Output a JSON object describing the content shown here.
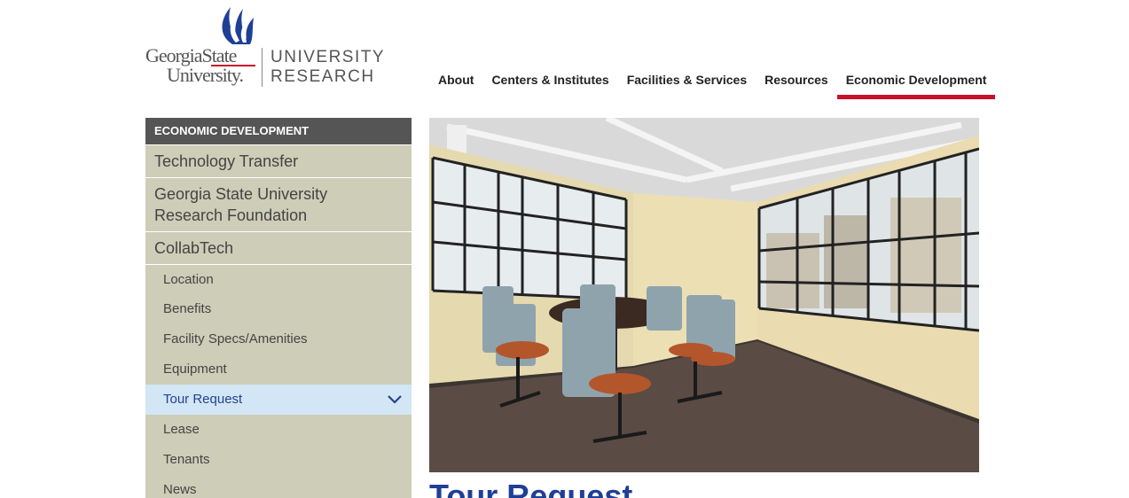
{
  "logo": {
    "line1": "GeorgiaState",
    "line2": "University.",
    "unit_line1": "UNIVERSITY",
    "unit_line2": "RESEARCH",
    "brand_blue": "#1f3f97",
    "brand_red": "#c8102e"
  },
  "topnav": {
    "items": [
      {
        "label": "About"
      },
      {
        "label": "Centers & Institutes"
      },
      {
        "label": "Facilities & Services"
      },
      {
        "label": "Resources"
      },
      {
        "label": "Economic Development"
      }
    ],
    "active_index": 4
  },
  "sidebar": {
    "header": "ECONOMIC DEVELOPMENT",
    "top_items": [
      {
        "label": "Technology Transfer"
      },
      {
        "label": "Georgia State University Research Foundation"
      },
      {
        "label": "CollabTech"
      }
    ],
    "sub_items": [
      {
        "label": "Location"
      },
      {
        "label": "Benefits"
      },
      {
        "label": "Facility Specs/Amenities"
      },
      {
        "label": "Equipment"
      },
      {
        "label": "Tour Request",
        "icon": "chevron-down-icon"
      },
      {
        "label": "Lease"
      },
      {
        "label": "Tenants"
      },
      {
        "label": "News"
      }
    ],
    "selected_sub_index": 4,
    "colors": {
      "tan": "#cdcdb8",
      "header": "#555555",
      "selected": "#d2e6f5",
      "selected_text": "#24428f"
    }
  },
  "main": {
    "heading": "Tour Request"
  }
}
